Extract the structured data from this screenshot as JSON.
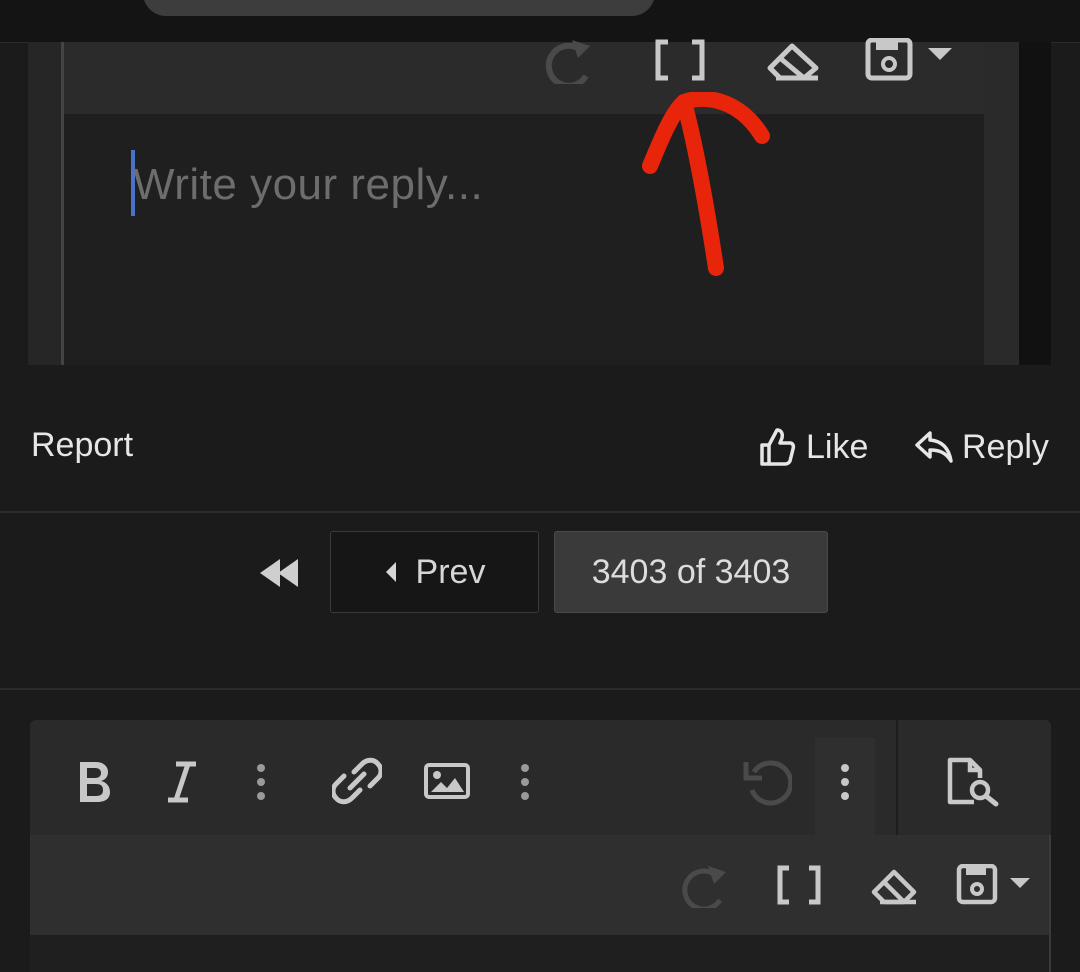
{
  "editor_top": {
    "placeholder": "Write your reply...",
    "toolbar_icons": [
      "redo-icon",
      "bbcode-icon",
      "remove-format-icon",
      "save-draft-icon",
      "caret-down-icon"
    ]
  },
  "annotation": {
    "color": "#e8250a",
    "icon": "red-arrow-annotation"
  },
  "post_actions": {
    "report_label": "Report",
    "like_label": "Like",
    "reply_label": "Reply"
  },
  "pagination": {
    "prev_label": "Prev",
    "current_page": 3403,
    "total_pages": 3403,
    "page_label": "3403 of 3403"
  },
  "editor_bottom": {
    "toolbar_icons": [
      "bold-icon",
      "italic-icon",
      "more-text-icon",
      "link-icon",
      "image-icon",
      "more-insert-icon",
      "undo-icon",
      "more-icon",
      "preview-icon",
      "redo-icon",
      "bbcode-icon",
      "remove-format-icon",
      "save-draft-icon",
      "caret-down-icon"
    ]
  },
  "colors": {
    "background": "#1b1b1b",
    "caret": "#4a72c8",
    "annotation": "#e8250a"
  }
}
